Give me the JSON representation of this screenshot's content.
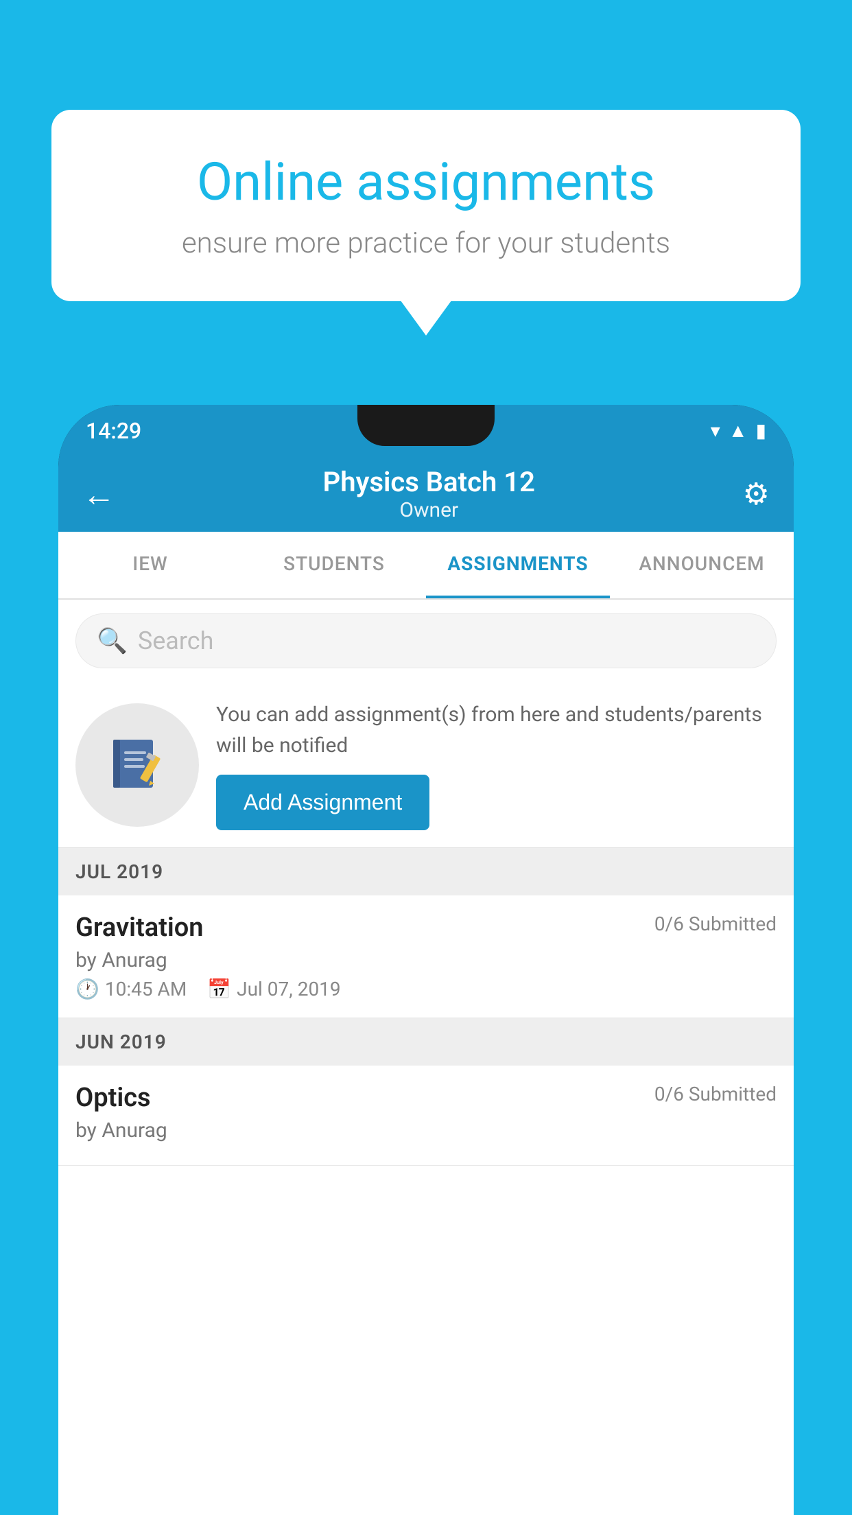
{
  "background_color": "#1ab8e8",
  "speech_bubble": {
    "title": "Online assignments",
    "subtitle": "ensure more practice for your students"
  },
  "status_bar": {
    "time": "14:29",
    "icons": [
      "wifi",
      "signal",
      "battery"
    ]
  },
  "app_bar": {
    "title": "Physics Batch 12",
    "subtitle": "Owner",
    "back_label": "←",
    "settings_label": "⚙"
  },
  "tabs": [
    {
      "label": "IEW",
      "active": false
    },
    {
      "label": "STUDENTS",
      "active": false
    },
    {
      "label": "ASSIGNMENTS",
      "active": true
    },
    {
      "label": "ANNOUNCEM",
      "active": false
    }
  ],
  "search": {
    "placeholder": "Search"
  },
  "empty_state": {
    "description": "You can add assignment(s) from here and students/parents will be notified",
    "button_label": "Add Assignment"
  },
  "sections": [
    {
      "label": "JUL 2019",
      "assignments": [
        {
          "title": "Gravitation",
          "submitted": "0/6 Submitted",
          "by": "by Anurag",
          "time": "10:45 AM",
          "date": "Jul 07, 2019"
        }
      ]
    },
    {
      "label": "JUN 2019",
      "assignments": [
        {
          "title": "Optics",
          "submitted": "0/6 Submitted",
          "by": "by Anurag",
          "time": "",
          "date": ""
        }
      ]
    }
  ]
}
